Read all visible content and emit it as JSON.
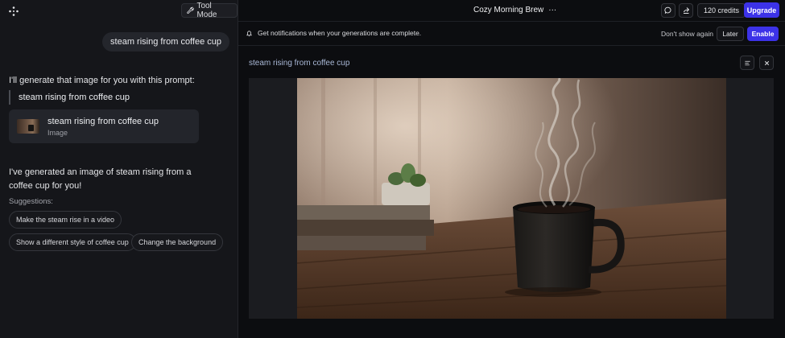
{
  "left_panel": {
    "tool_mode_label": "Tool Mode",
    "user_message": "steam rising from coffee cup",
    "assistant_intro": "I'll generate that image for you with this prompt:",
    "prompt_quote": "steam rising from coffee cup",
    "image_card": {
      "title": "steam rising from coffee cup",
      "type": "Image"
    },
    "completion_message": "I've generated an image of steam rising from a coffee cup for you!",
    "suggestions_label": "Suggestions:",
    "suggestions": [
      "Make the steam rise in a video",
      "Show a different style of coffee cup",
      "Change the background"
    ]
  },
  "header": {
    "project_title": "Cozy Morning Brew",
    "more_glyph": "···",
    "credits": "120 credits",
    "upgrade_label": "Upgrade"
  },
  "notification": {
    "text": "Get notifications when your generations are complete.",
    "dont_show": "Don't show again",
    "later": "Later",
    "enable": "Enable"
  },
  "generation": {
    "title": "steam rising from coffee cup"
  },
  "colors": {
    "accent": "#3c32e8",
    "panel_bg": "#15161a",
    "app_bg": "#0c0d10"
  },
  "icons": [
    "logo-icon",
    "wrench-icon",
    "chat-icon",
    "share-icon",
    "bell-icon",
    "list-icon",
    "close-icon"
  ]
}
